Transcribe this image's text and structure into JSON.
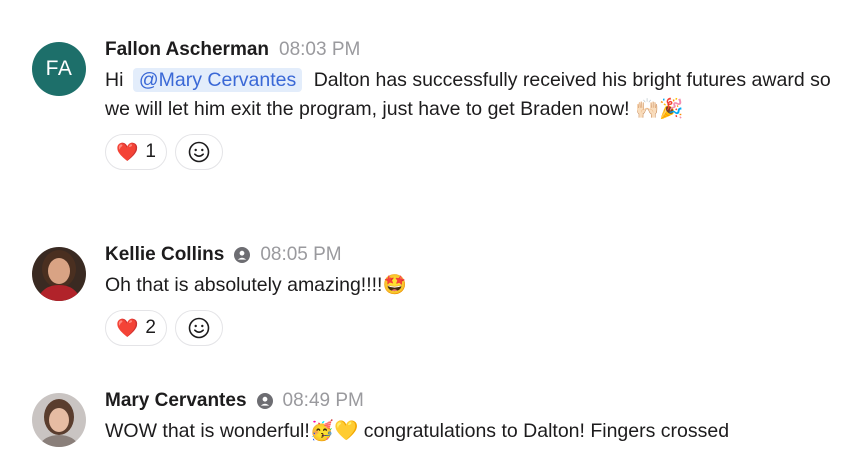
{
  "messages": [
    {
      "avatar_initials": "FA",
      "name": "Fallon Ascherman",
      "time": "08:03 PM",
      "text_before_mention": "Hi",
      "mention": "@Mary Cervantes",
      "text_after_mention": "Dalton has successfully received his bright futures award so we will let him exit the program, just have to get Braden now! 🙌🏻🎉",
      "reactions": [
        {
          "emoji": "❤️",
          "count": "1"
        }
      ]
    },
    {
      "name": "Kellie Collins",
      "time": "08:05 PM",
      "text": "Oh that is absolutely amazing!!!!🤩",
      "reactions": [
        {
          "emoji": "❤️",
          "count": "2"
        }
      ]
    },
    {
      "name": "Mary Cervantes",
      "time": "08:49 PM",
      "text": "WOW that is wonderful!🥳💛 congratulations to Dalton! Fingers crossed"
    }
  ],
  "colors": {
    "avatar_bg": "#1d6f6a",
    "mention_bg": "#e3edfb",
    "mention_text": "#3a68d6",
    "timestamp": "#9a9a9e",
    "heart": "#e0245e"
  },
  "icons": {
    "presence": "user-presence-icon",
    "add_reaction": "smiley-add-reaction-icon"
  }
}
